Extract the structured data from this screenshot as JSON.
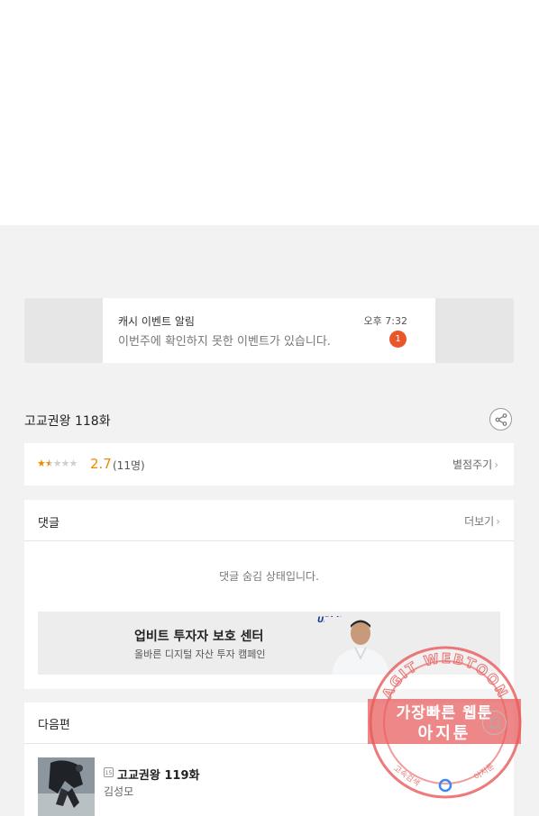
{
  "notification": {
    "title": "캐시 이벤트 알림",
    "time": "오후 7:32",
    "message": "이번주에 확인하지 못한 이벤트가 있습니다.",
    "badge_count": "1",
    "badge_color": "#e8562a"
  },
  "episode": {
    "title": "고교권왕 118화",
    "share_icon": "share-icon"
  },
  "rating": {
    "stars_value": 2.7,
    "stars_max": 5,
    "value": "2.7",
    "count": "(11명)",
    "rate_link": "별점주기",
    "accent_color": "#f08a00"
  },
  "comments": {
    "title": "댓글",
    "more": "더보기",
    "hidden_message": "댓글 숨김 상태입니다."
  },
  "ad": {
    "title": "업비트 투자자 보호 센터",
    "subtitle": "올바른 디지털 자산 투자 캠페인",
    "logo": "UPbit"
  },
  "next": {
    "title": "다음편",
    "age_badge": "15",
    "episode_title": "고교권왕 119화",
    "author": "김성모",
    "bell_icon": "bell-icon"
  },
  "watermark": {
    "line1": "가장빠른 웹툰",
    "line2": "아지툰",
    "ring_text": "AGIT WEBTOON",
    "bottom_left": "고속검색",
    "bottom_right": "아지툰",
    "color": "#e85a5a"
  }
}
